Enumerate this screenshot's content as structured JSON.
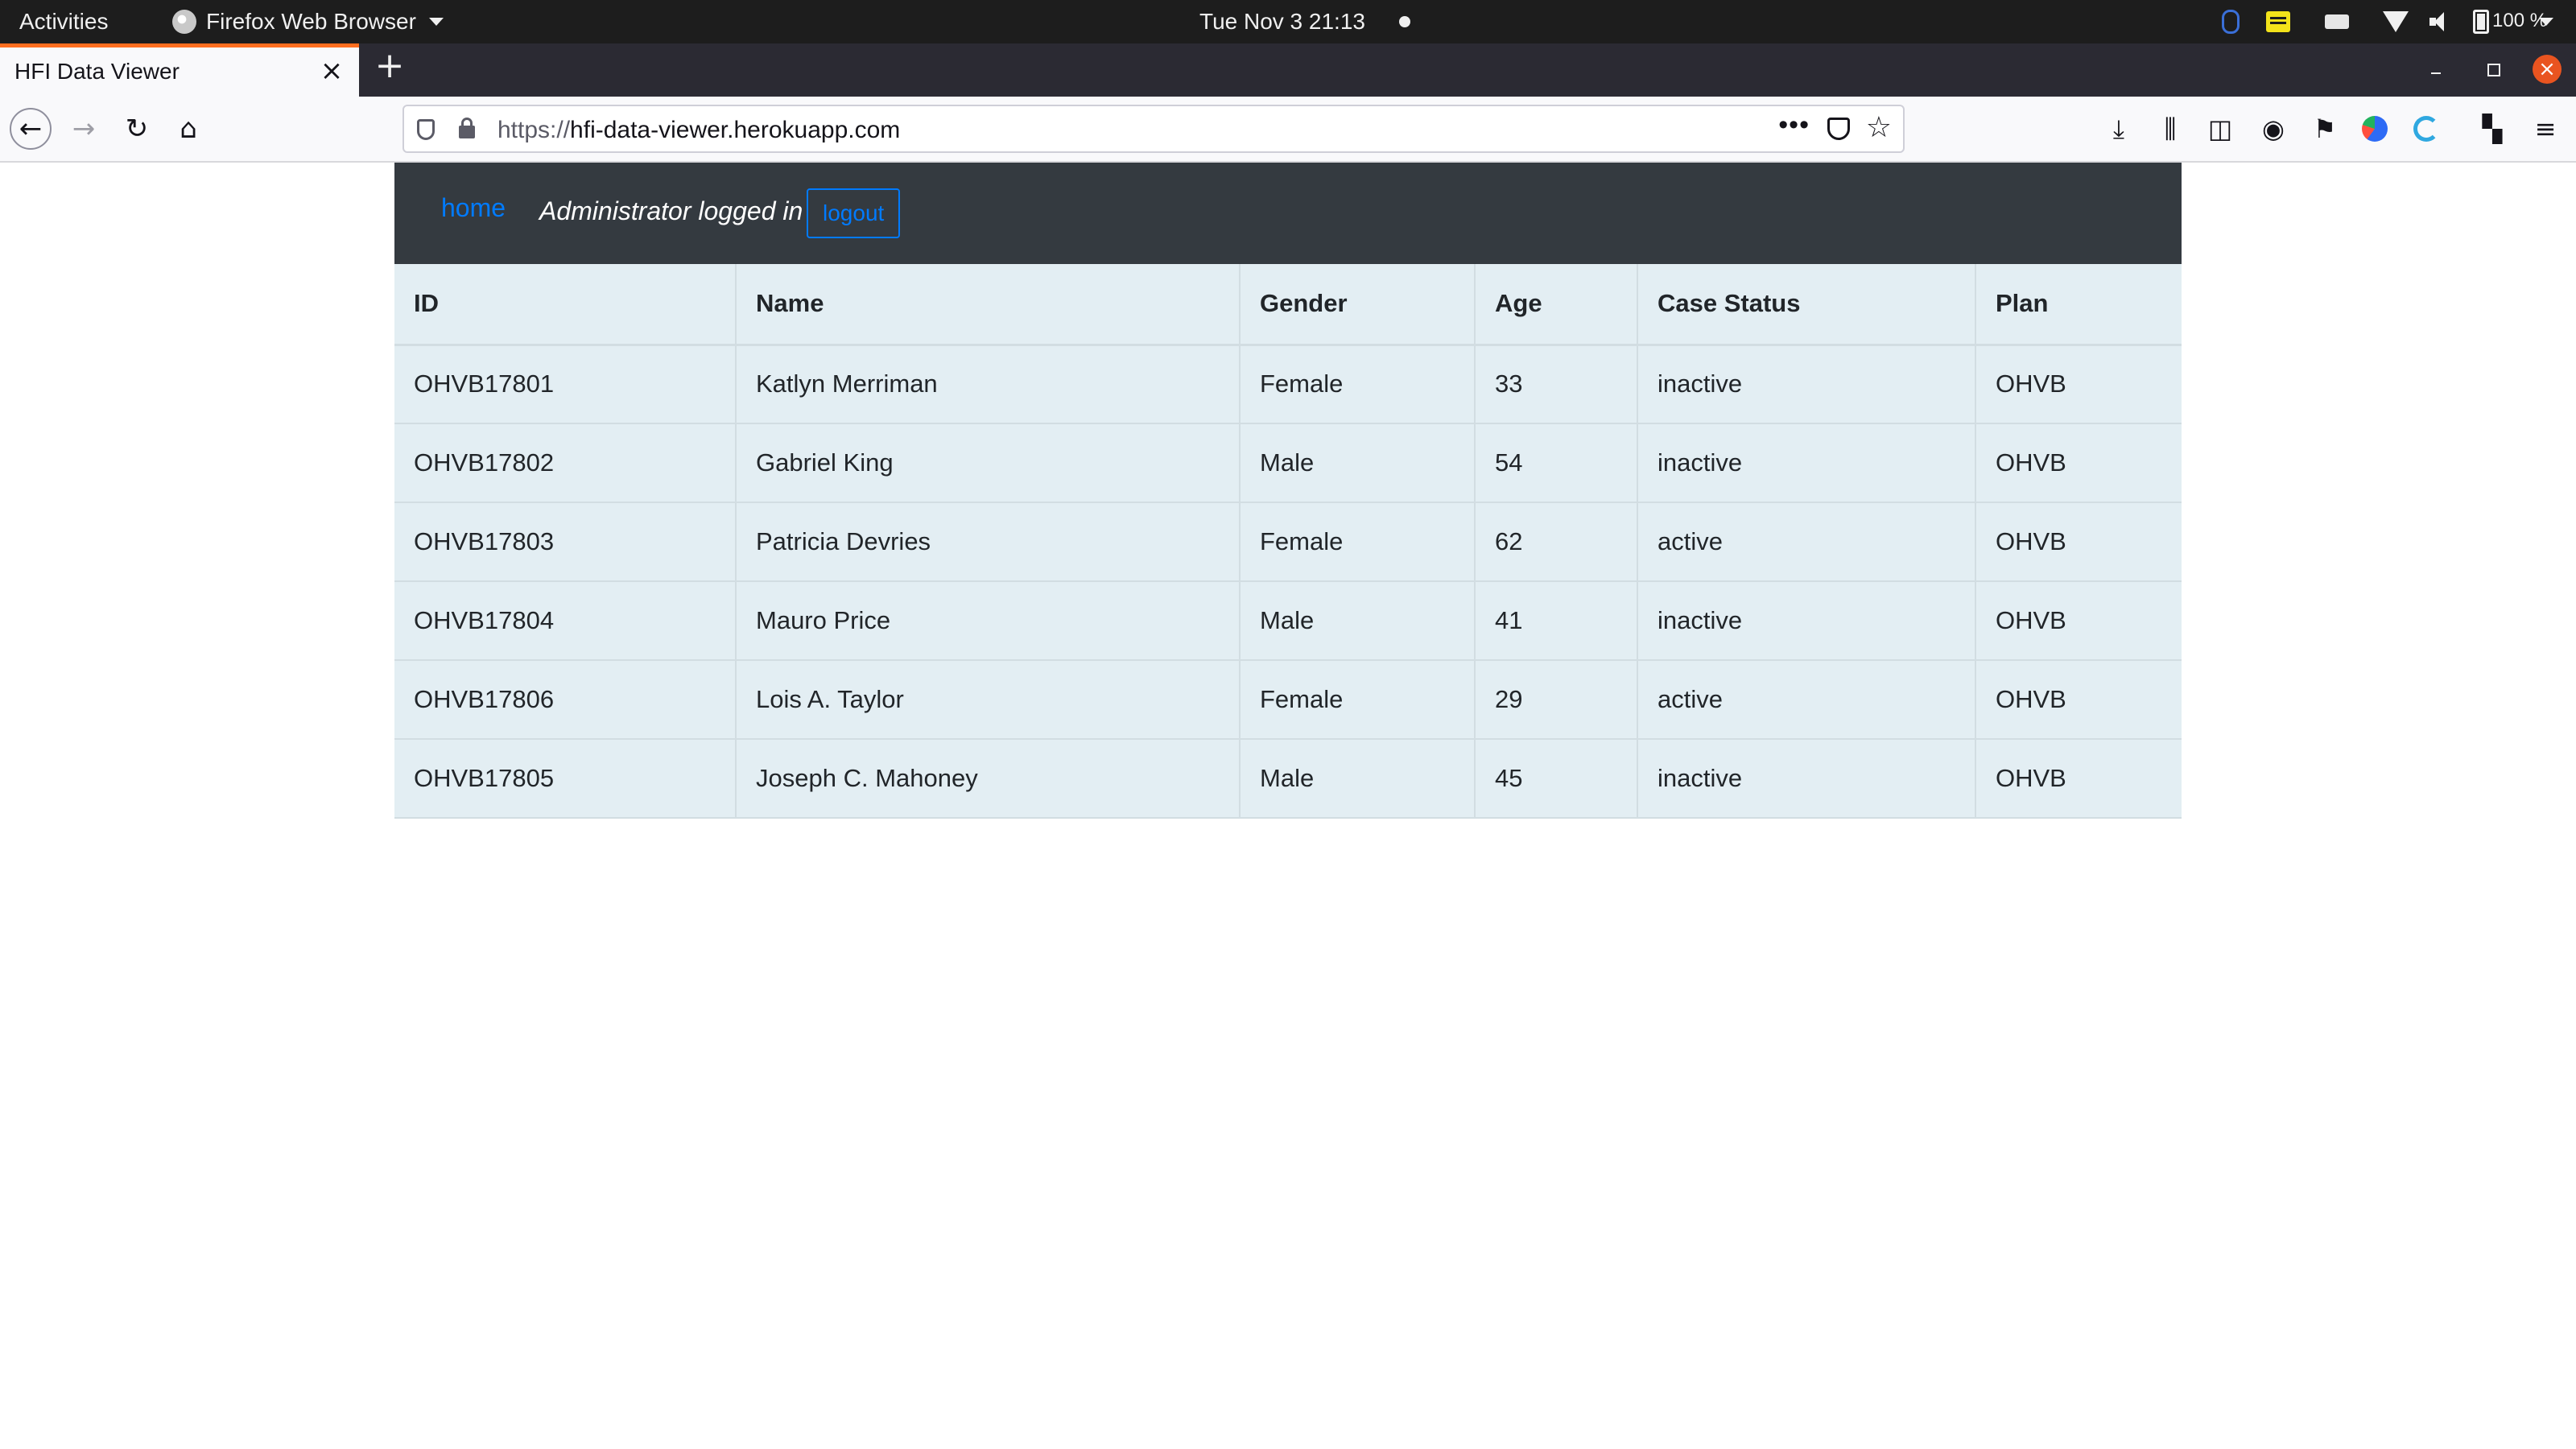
{
  "system_bar": {
    "activities": "Activities",
    "app_name": "Firefox Web Browser",
    "clock": "Tue Nov 3  21:13",
    "battery": "100 %"
  },
  "browser": {
    "tab_title": "HFI Data Viewer",
    "url_scheme": "https://",
    "url_host": "hfi-data-viewer.herokuapp.com"
  },
  "app_nav": {
    "home_label": "home",
    "status_text": "Administrator logged in",
    "logout_label": "logout"
  },
  "table": {
    "headers": [
      "ID",
      "Name",
      "Gender",
      "Age",
      "Case Status",
      "Plan"
    ],
    "rows": [
      [
        "OHVB17801",
        "Katlyn Merriman",
        "Female",
        "33",
        "inactive",
        "OHVB"
      ],
      [
        "OHVB17802",
        "Gabriel King",
        "Male",
        "54",
        "inactive",
        "OHVB"
      ],
      [
        "OHVB17803",
        "Patricia Devries",
        "Female",
        "62",
        "active",
        "OHVB"
      ],
      [
        "OHVB17804",
        "Mauro Price",
        "Male",
        "41",
        "inactive",
        "OHVB"
      ],
      [
        "OHVB17806",
        "Lois A. Taylor",
        "Female",
        "29",
        "active",
        "OHVB"
      ],
      [
        "OHVB17805",
        "Joseph C. Mahoney",
        "Male",
        "45",
        "inactive",
        "OHVB"
      ]
    ]
  },
  "colors": {
    "navbar_bg": "#343a40",
    "link_blue": "#007bff",
    "table_bg": "#e3eef3",
    "tab_accent": "#ff6e1f",
    "close_button": "#e95420"
  },
  "icons": {
    "app_logo": "firefox-icon",
    "tray": [
      "bluetooth-icon",
      "notes-icon",
      "keyboard-icon",
      "wifi-icon",
      "volume-icon",
      "battery-icon"
    ],
    "toolbar": [
      "download-icon",
      "library-icon",
      "sidebar-icon",
      "account-icon",
      "flag-icon",
      "extension-icon",
      "extension-icon",
      "extensions-icon",
      "menu-icon"
    ]
  }
}
